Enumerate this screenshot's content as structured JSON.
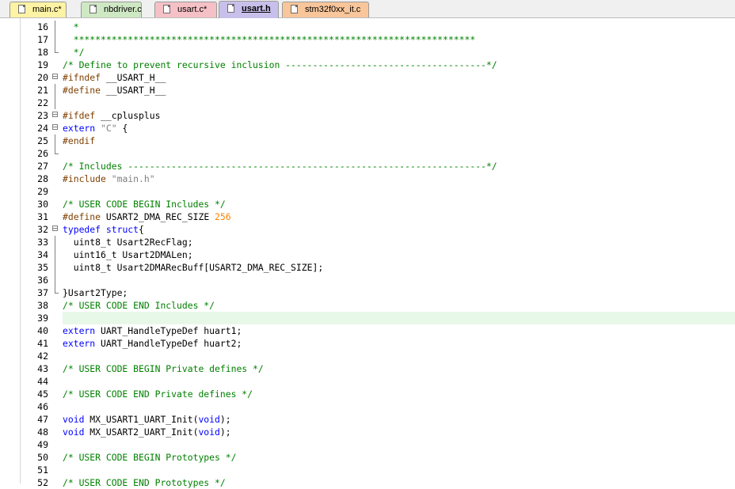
{
  "tabs": [
    {
      "label": "main.c*",
      "color": "#fdf3a4",
      "active": false,
      "name": "tab-main-c"
    },
    {
      "label": "nbdriver.c",
      "color": "#cfe8c4",
      "active": false,
      "name": "tab-nbdriver-c"
    },
    {
      "label": "usart.c*",
      "color": "#f6c1c6",
      "active": false,
      "name": "tab-usart-c"
    },
    {
      "label": "usart.h",
      "color": "#c8c0ea",
      "active": true,
      "name": "tab-usart-h"
    },
    {
      "label": "stm32f0xx_it.c",
      "color": "#f8c69a",
      "active": false,
      "name": "tab-stm32f0xx-it-c"
    }
  ],
  "colors": {
    "comment": "#008000",
    "preprocessor": "#804000",
    "keyword": "#0000ff",
    "string": "#808080",
    "number": "#ff8000",
    "current_line": "#e8f8e8"
  },
  "highlighted_line": 39,
  "lines": [
    {
      "n": "16",
      "fold": "bar",
      "tokens": [
        [
          "  *",
          "com"
        ]
      ]
    },
    {
      "n": "17",
      "fold": "bar",
      "tokens": [
        [
          "  **************************************************************************",
          "com"
        ]
      ]
    },
    {
      "n": "18",
      "fold": "end",
      "tokens": [
        [
          "  */",
          "com"
        ]
      ]
    },
    {
      "n": "19",
      "fold": "",
      "tokens": [
        [
          "/* Define to prevent recursive inclusion -------------------------------------*/",
          "com"
        ]
      ]
    },
    {
      "n": "20",
      "fold": "box",
      "tokens": [
        [
          "#ifndef",
          "pp"
        ],
        [
          " __USART_H__",
          ""
        ]
      ]
    },
    {
      "n": "21",
      "fold": "bar",
      "tokens": [
        [
          "#define",
          "pp"
        ],
        [
          " __USART_H__",
          ""
        ]
      ]
    },
    {
      "n": "22",
      "fold": "bar",
      "tokens": []
    },
    {
      "n": "23",
      "fold": "box",
      "tokens": [
        [
          "#ifdef",
          "pp"
        ],
        [
          " __cplusplus",
          ""
        ]
      ]
    },
    {
      "n": "24",
      "fold": "box",
      "tokens": [
        [
          "extern",
          "kw"
        ],
        [
          " ",
          ""
        ],
        [
          "\"C\"",
          "str"
        ],
        [
          " {",
          ""
        ]
      ]
    },
    {
      "n": "25",
      "fold": "bar",
      "tokens": [
        [
          "#endif",
          "pp"
        ]
      ]
    },
    {
      "n": "26",
      "fold": "end",
      "tokens": []
    },
    {
      "n": "27",
      "fold": "",
      "tokens": [
        [
          "/* Includes ------------------------------------------------------------------*/",
          "com"
        ]
      ]
    },
    {
      "n": "28",
      "fold": "",
      "tokens": [
        [
          "#include",
          "pp"
        ],
        [
          " ",
          ""
        ],
        [
          "\"main.h\"",
          "str"
        ]
      ]
    },
    {
      "n": "29",
      "fold": "",
      "tokens": []
    },
    {
      "n": "30",
      "fold": "",
      "tokens": [
        [
          "/* USER CODE BEGIN Includes */",
          "com"
        ]
      ]
    },
    {
      "n": "31",
      "fold": "",
      "tokens": [
        [
          "#define",
          "pp"
        ],
        [
          " USART2_DMA_REC_SIZE ",
          ""
        ],
        [
          "256",
          "num"
        ]
      ]
    },
    {
      "n": "32",
      "fold": "box",
      "tokens": [
        [
          "typedef",
          "kw"
        ],
        [
          " ",
          ""
        ],
        [
          "struct",
          "kw"
        ],
        [
          "{",
          ""
        ]
      ]
    },
    {
      "n": "33",
      "fold": "bar",
      "tokens": [
        [
          "  uint8_t Usart2RecFlag;",
          ""
        ]
      ]
    },
    {
      "n": "34",
      "fold": "bar",
      "tokens": [
        [
          "  uint16_t Usart2DMALen;",
          ""
        ]
      ]
    },
    {
      "n": "35",
      "fold": "bar",
      "tokens": [
        [
          "  uint8_t Usart2DMARecBuff[USART2_DMA_REC_SIZE];",
          ""
        ]
      ]
    },
    {
      "n": "36",
      "fold": "bar",
      "tokens": []
    },
    {
      "n": "37",
      "fold": "end",
      "tokens": [
        [
          "}Usart2Type;",
          ""
        ]
      ]
    },
    {
      "n": "38",
      "fold": "",
      "tokens": [
        [
          "/* USER CODE END Includes */",
          "com"
        ]
      ]
    },
    {
      "n": "39",
      "fold": "",
      "tokens": []
    },
    {
      "n": "40",
      "fold": "",
      "tokens": [
        [
          "extern",
          "kw"
        ],
        [
          " UART_HandleTypeDef huart1;",
          ""
        ]
      ]
    },
    {
      "n": "41",
      "fold": "",
      "tokens": [
        [
          "extern",
          "kw"
        ],
        [
          " UART_HandleTypeDef huart2;",
          ""
        ]
      ]
    },
    {
      "n": "42",
      "fold": "",
      "tokens": []
    },
    {
      "n": "43",
      "fold": "",
      "tokens": [
        [
          "/* USER CODE BEGIN Private defines */",
          "com"
        ]
      ]
    },
    {
      "n": "44",
      "fold": "",
      "tokens": []
    },
    {
      "n": "45",
      "fold": "",
      "tokens": [
        [
          "/* USER CODE END Private defines */",
          "com"
        ]
      ]
    },
    {
      "n": "46",
      "fold": "",
      "tokens": []
    },
    {
      "n": "47",
      "fold": "",
      "tokens": [
        [
          "void",
          "kw"
        ],
        [
          " MX_USART1_UART_Init(",
          ""
        ],
        [
          "void",
          "kw"
        ],
        [
          ");",
          ""
        ]
      ]
    },
    {
      "n": "48",
      "fold": "",
      "tokens": [
        [
          "void",
          "kw"
        ],
        [
          " MX_USART2_UART_Init(",
          ""
        ],
        [
          "void",
          "kw"
        ],
        [
          ");",
          ""
        ]
      ]
    },
    {
      "n": "49",
      "fold": "",
      "tokens": []
    },
    {
      "n": "50",
      "fold": "",
      "tokens": [
        [
          "/* USER CODE BEGIN Prototypes */",
          "com"
        ]
      ]
    },
    {
      "n": "51",
      "fold": "",
      "tokens": []
    },
    {
      "n": "52",
      "fold": "",
      "tokens": [
        [
          "/* USER CODE END Prototypes */",
          "com"
        ]
      ]
    }
  ]
}
